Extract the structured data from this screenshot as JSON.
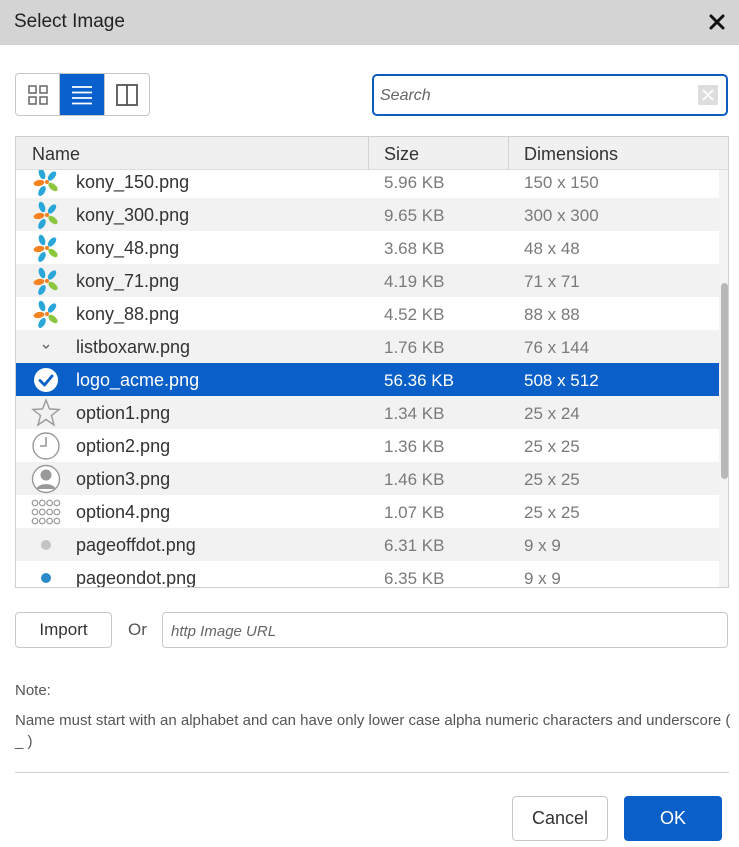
{
  "dialog": {
    "title": "Select Image",
    "close_icon": "close-icon"
  },
  "toolbar": {
    "views": [
      {
        "icon": "grid-view-icon",
        "active": false
      },
      {
        "icon": "list-view-icon",
        "active": true
      },
      {
        "icon": "split-view-icon",
        "active": false
      }
    ],
    "search_placeholder": "Search",
    "search_value": "",
    "search_clear_icon": "clear-icon"
  },
  "table": {
    "columns": [
      "Name",
      "Size",
      "Dimensions"
    ],
    "rows": [
      {
        "icon": "kony-logo-icon",
        "name": "kony_150.png",
        "size": "5.96 KB",
        "dimensions": "150 x 150",
        "selected": false
      },
      {
        "icon": "kony-logo-icon",
        "name": "kony_300.png",
        "size": "9.65 KB",
        "dimensions": "300 x 300",
        "selected": false
      },
      {
        "icon": "kony-logo-icon",
        "name": "kony_48.png",
        "size": "3.68 KB",
        "dimensions": "48 x 48",
        "selected": false
      },
      {
        "icon": "kony-logo-icon",
        "name": "kony_71.png",
        "size": "4.19 KB",
        "dimensions": "71 x 71",
        "selected": false
      },
      {
        "icon": "kony-logo-icon",
        "name": "kony_88.png",
        "size": "4.52 KB",
        "dimensions": "88 x 88",
        "selected": false
      },
      {
        "icon": "chevron-down-icon",
        "name": "listboxarw.png",
        "size": "1.76 KB",
        "dimensions": "76 x 144",
        "selected": false
      },
      {
        "icon": "check-circle-icon",
        "name": "logo_acme.png",
        "size": "56.36 KB",
        "dimensions": "508 x 512",
        "selected": true
      },
      {
        "icon": "star-icon",
        "name": "option1.png",
        "size": "1.34 KB",
        "dimensions": "25 x 24",
        "selected": false
      },
      {
        "icon": "clock-icon",
        "name": "option2.png",
        "size": "1.36 KB",
        "dimensions": "25 x 25",
        "selected": false
      },
      {
        "icon": "person-icon",
        "name": "option3.png",
        "size": "1.46 KB",
        "dimensions": "25 x 25",
        "selected": false
      },
      {
        "icon": "keypad-icon",
        "name": "option4.png",
        "size": "1.07 KB",
        "dimensions": "25 x 25",
        "selected": false
      },
      {
        "icon": "gray-dot-icon",
        "name": "pageoffdot.png",
        "size": "6.31 KB",
        "dimensions": "9 x 9",
        "selected": false
      },
      {
        "icon": "blue-dot-icon",
        "name": "pageondot.png",
        "size": "6.35 KB",
        "dimensions": "9 x 9",
        "selected": false
      }
    ]
  },
  "import": {
    "button_label": "Import",
    "or_label": "Or",
    "url_placeholder": "http Image URL",
    "url_value": ""
  },
  "note": {
    "label": "Note:",
    "text": "Name must start with an alphabet and can have only lower case alpha numeric characters and underscore ( _ )"
  },
  "footer": {
    "cancel_label": "Cancel",
    "ok_label": "OK"
  },
  "colors": {
    "accent": "#0a5fc8",
    "titlebar": "#d4d4d4"
  }
}
